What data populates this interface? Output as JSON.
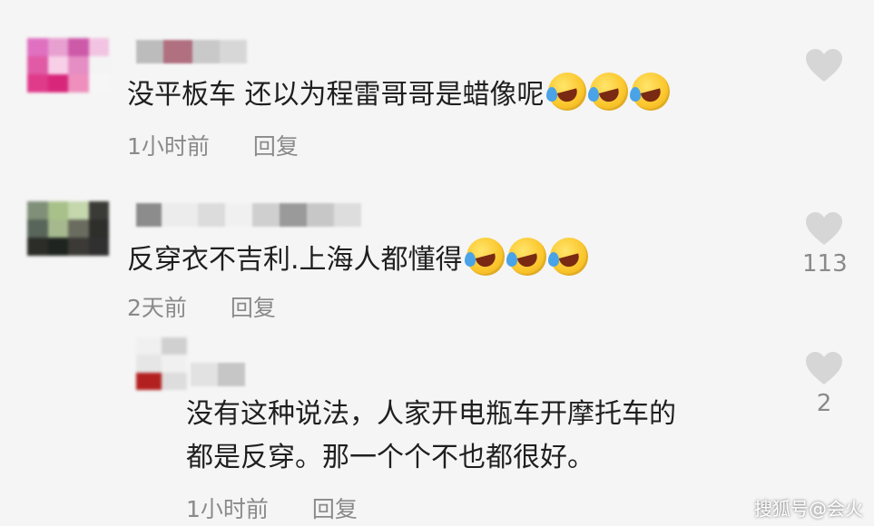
{
  "comments": [
    {
      "text": "没平板车 还以为程雷哥哥是蜡像呢",
      "emoji_count": 3,
      "time": "1小时前",
      "reply_label": "回复",
      "likes": ""
    },
    {
      "text": "反穿衣不吉利.上海人都懂得",
      "emoji_count": 3,
      "time": "2天前",
      "reply_label": "回复",
      "likes": "113"
    }
  ],
  "reply": {
    "line1": "没有这种说法，人家开电瓶车开摩托车的",
    "line2": "都是反穿。那一个个不也都很好。",
    "time": "1小时前",
    "reply_label": "回复",
    "likes": "2"
  },
  "watermark": "搜狐号@会火",
  "icons": {
    "like": "heart-icon",
    "emoji": "rofl-emoji-icon"
  },
  "colors": {
    "background": "#f5f5f5",
    "meta_text": "#8a8a8a",
    "heart": "#d6d6d6"
  }
}
